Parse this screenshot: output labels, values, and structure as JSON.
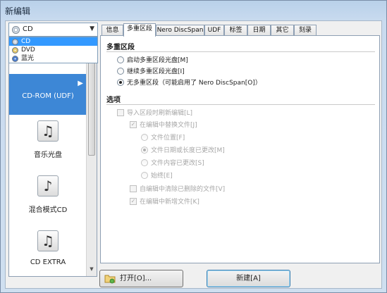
{
  "window": {
    "title": "新编辑"
  },
  "disc_type": {
    "selected": "CD",
    "options": [
      "CD",
      "DVD",
      "蓝光"
    ]
  },
  "project_list": {
    "items": [
      {
        "label": "CD-ROM (UDF)",
        "selected": true
      },
      {
        "label": "音乐光盘",
        "selected": false
      },
      {
        "label": "混合模式CD",
        "selected": false
      },
      {
        "label": "CD EXTRA",
        "selected": false
      }
    ]
  },
  "tabs": [
    "信息",
    "多重区段",
    "Nero DiscSpan",
    "UDF",
    "标签",
    "日期",
    "其它",
    "刻录"
  ],
  "active_tab": "多重区段",
  "multisession": {
    "title": "多重区段",
    "options": [
      {
        "label": "启动多重区段光盘[M]",
        "checked": false
      },
      {
        "label": "继续多重区段光盘[I]",
        "checked": false
      },
      {
        "label": "无多重区段（可能启用了 Nero DiscSpan[O]）",
        "checked": true
      }
    ]
  },
  "options_section": {
    "title": "选项",
    "import_refresh": "导入区段时刷新编辑[L]",
    "replace_in_edit": "在编辑中替换文件[J]",
    "file_position": "文件位置[F]",
    "date_or_length_changed": "文件日期或长度已更改[M]",
    "content_changed": "文件内容已更改[S]",
    "always": "始终[E]",
    "delete_removed": "自编辑中清除已删除的文件[V]",
    "new_files_in_edit": "在编辑中新增文件[K]"
  },
  "buttons": {
    "open": "打开[O]...",
    "new": "新建[A]"
  },
  "colors": {
    "selection": "#3d87d6",
    "dropdown_highlight": "#3399ff"
  }
}
